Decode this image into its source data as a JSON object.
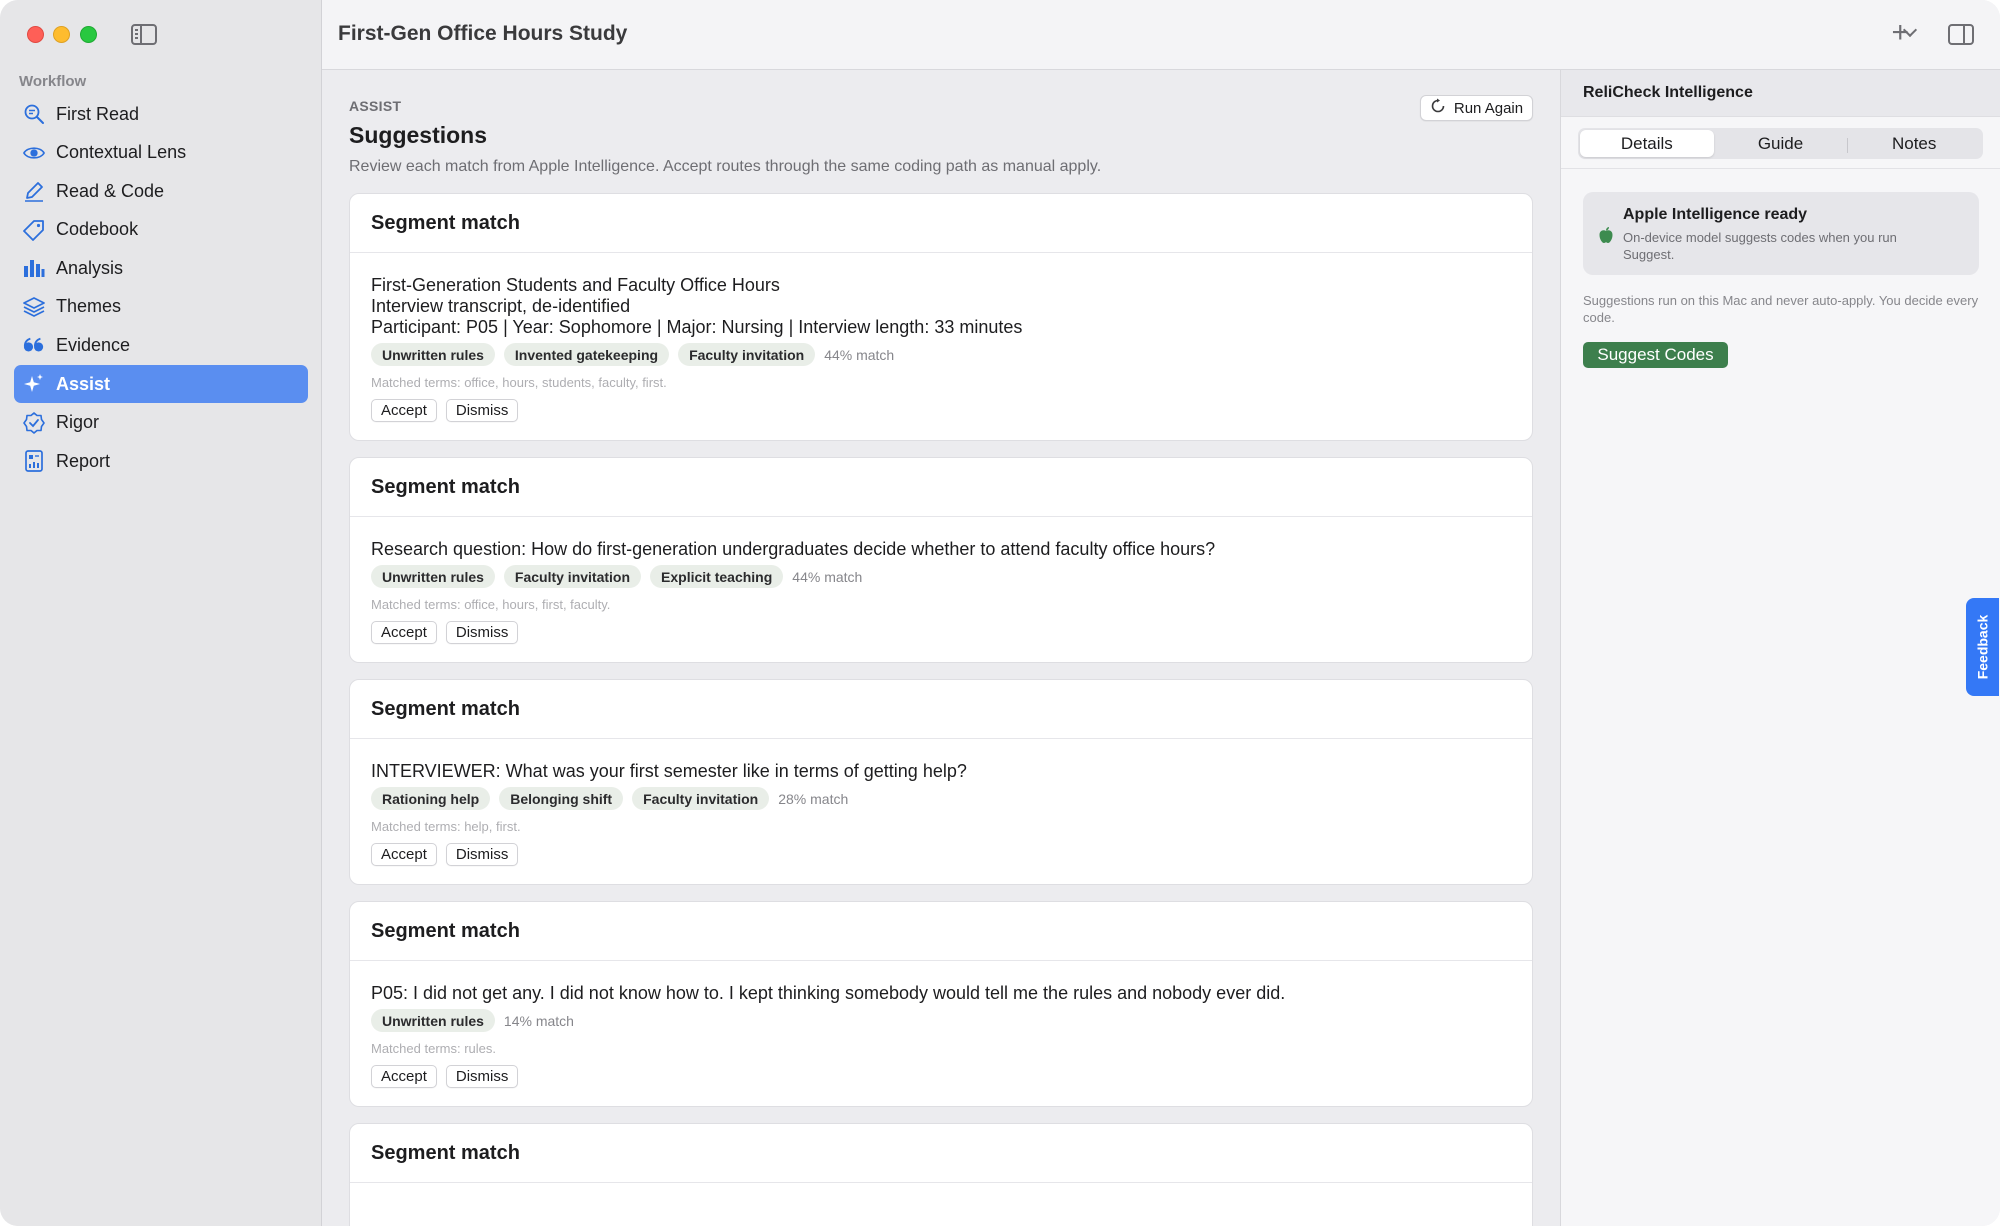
{
  "window": {
    "title": "First-Gen Office Hours Study"
  },
  "sidebar": {
    "section_label": "Workflow",
    "items": [
      {
        "label": "First Read",
        "icon": "magnifier-text-icon"
      },
      {
        "label": "Contextual Lens",
        "icon": "eye-icon"
      },
      {
        "label": "Read & Code",
        "icon": "pencil-icon"
      },
      {
        "label": "Codebook",
        "icon": "tag-icon"
      },
      {
        "label": "Analysis",
        "icon": "bar-chart-icon"
      },
      {
        "label": "Themes",
        "icon": "layers-icon"
      },
      {
        "label": "Evidence",
        "icon": "quote-icon"
      },
      {
        "label": "Assist",
        "icon": "sparkles-icon",
        "active": true
      },
      {
        "label": "Rigor",
        "icon": "checkmark-seal-icon"
      },
      {
        "label": "Report",
        "icon": "document-chart-icon"
      }
    ]
  },
  "main": {
    "kicker": "ASSIST",
    "title": "Suggestions",
    "subtitle": "Review each match from Apple Intelligence. Accept routes through the same coding path as manual apply.",
    "run_again_label": "Run Again",
    "cards": [
      {
        "header": "Segment match",
        "lines": [
          "First-Generation Students and Faculty Office Hours",
          "Interview transcript, de-identified",
          "Participant: P05 | Year: Sophomore | Major: Nursing | Interview length: 33 minutes"
        ],
        "tags": [
          "Unwritten rules",
          "Invented gatekeeping",
          "Faculty invitation"
        ],
        "match": "44% match",
        "matched_terms": "Matched terms: office, hours, students, faculty, first.",
        "accept": "Accept",
        "dismiss": "Dismiss"
      },
      {
        "header": "Segment match",
        "lines": [
          "Research question: How do first-generation undergraduates decide whether to attend faculty office hours?"
        ],
        "tags": [
          "Unwritten rules",
          "Faculty invitation",
          "Explicit teaching"
        ],
        "match": "44% match",
        "matched_terms": "Matched terms: office, hours, first, faculty.",
        "accept": "Accept",
        "dismiss": "Dismiss"
      },
      {
        "header": "Segment match",
        "lines": [
          "INTERVIEWER: What was your first semester like in terms of getting help?"
        ],
        "tags": [
          "Rationing help",
          "Belonging shift",
          "Faculty invitation"
        ],
        "match": "28% match",
        "matched_terms": "Matched terms: help, first.",
        "accept": "Accept",
        "dismiss": "Dismiss"
      },
      {
        "header": "Segment match",
        "lines": [
          "P05: I did not get any. I did not know how to. I kept thinking somebody would tell me the rules and nobody ever did."
        ],
        "tags": [
          "Unwritten rules"
        ],
        "match": "14% match",
        "matched_terms": "Matched terms: rules.",
        "accept": "Accept",
        "dismiss": "Dismiss"
      },
      {
        "header": "Segment match"
      }
    ]
  },
  "inspector": {
    "title": "ReliCheck Intelligence",
    "tabs": [
      "Details",
      "Guide",
      "Notes"
    ],
    "selected_tab": "Details",
    "ai_card": {
      "title": "Apple Intelligence ready",
      "description": "On-device model suggests codes when you run Suggest.",
      "icon": "apple-icon"
    },
    "note": "Suggestions run on this Mac and never auto-apply. You decide every code.",
    "suggest_label": "Suggest Codes"
  },
  "feedback_label": "Feedback",
  "colors": {
    "accent": "#5a8ef0",
    "suggest_green": "#3d7f4d",
    "feedback_blue": "#3478f6",
    "tag_bg": "#e9eee8"
  }
}
